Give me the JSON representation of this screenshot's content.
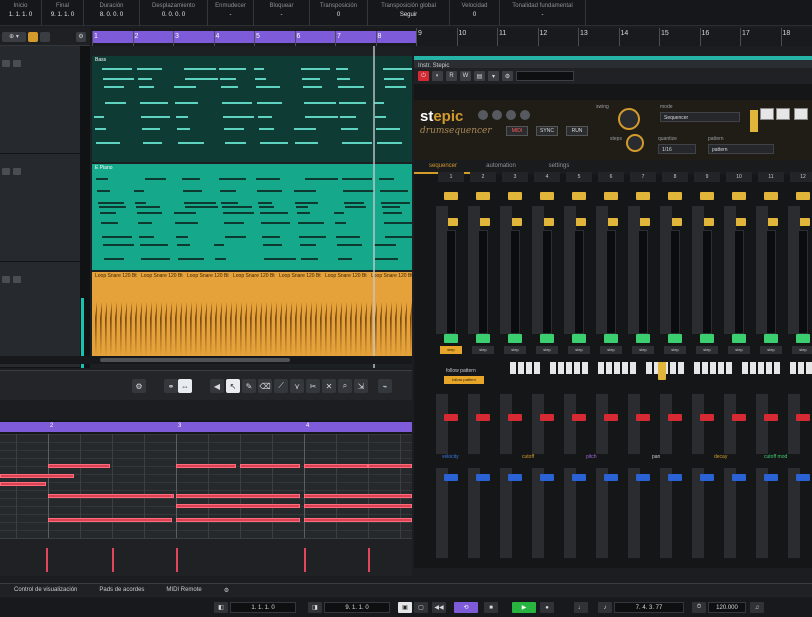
{
  "infoline": [
    {
      "label": "Inicio",
      "value": "1. 1. 1. 0"
    },
    {
      "label": "Final",
      "value": "9. 1. 1. 0"
    },
    {
      "label": "Duración",
      "value": "8. 0. 0. 0"
    },
    {
      "label": "Desplazamiento",
      "value": "0. 0. 0. 0"
    },
    {
      "label": "Enmudecer",
      "value": "-"
    },
    {
      "label": "Bloquear",
      "value": "-"
    },
    {
      "label": "Transposición",
      "value": "0"
    },
    {
      "label": "Transposición global",
      "value": "Seguir"
    },
    {
      "label": "Velocidad",
      "value": "0"
    },
    {
      "label": "Tonalidad fundamental",
      "value": "-"
    }
  ],
  "ruler_ticks": [
    "1",
    "2",
    "3",
    "4",
    "5",
    "6",
    "7",
    "8",
    "9",
    "10",
    "11",
    "12",
    "13",
    "14",
    "15",
    "16",
    "17",
    "18"
  ],
  "parts": {
    "midi1": "Bass",
    "midi2": "E Piano",
    "audio": [
      "Loop Snare 120 Bt",
      "Loop Snare 120 Bt",
      "Loop Snare 120 Bt",
      "Loop Snare 120 Bt",
      "Loop Snare 120 Bt",
      "Loop Snare 120 Bt",
      "Loop Snare 120 Bt"
    ]
  },
  "editor_ticks": [
    "2",
    "3",
    "4"
  ],
  "plugin": {
    "title": "Instr. Stepic",
    "logo_a": "st",
    "logo_b": "epic",
    "logo_sub": "drumsequencer",
    "mode_buttons": [
      "MIDI",
      "SYNC",
      "RUN"
    ],
    "labels": {
      "swing": "swing",
      "mode": "mode",
      "mode_value": "Sequencer",
      "steps": "steps",
      "quantize": "quantize",
      "quantize_value": "1/16",
      "pattern": "pattern",
      "pattern_value": "pattern"
    },
    "tabs": [
      "sequencer",
      "automation",
      "settings"
    ],
    "steps": [
      "1",
      "2",
      "3",
      "4",
      "5",
      "6",
      "7",
      "8",
      "9",
      "10",
      "11",
      "12"
    ],
    "step_small": "step",
    "step_small_active": "step",
    "follow": "follow pattern",
    "follow_btn": "follow pattern",
    "section_labels": [
      "velocity",
      "cutoff",
      "pitch",
      "pan",
      "decay",
      "cutoff mod"
    ],
    "section_colors": [
      "#3a79e6",
      "#d39b2c",
      "#9c6ad9",
      "#c9ccd1",
      "#d39b2c",
      "#3ccf70"
    ]
  },
  "bottom_tabs": [
    "Control de visualización",
    "Pads de acordes",
    "MIDI Remote",
    "⚙"
  ],
  "transport": {
    "pos1": "1. 1. 1. 0",
    "pos2": "9. 1. 1. 0",
    "pos3": "7. 4. 3. 77",
    "tempo": "120.000"
  },
  "colors": {
    "accent": "#7d5bd9",
    "midi": "#15a88a",
    "audio": "#e6a23a",
    "note": "#d94253"
  }
}
